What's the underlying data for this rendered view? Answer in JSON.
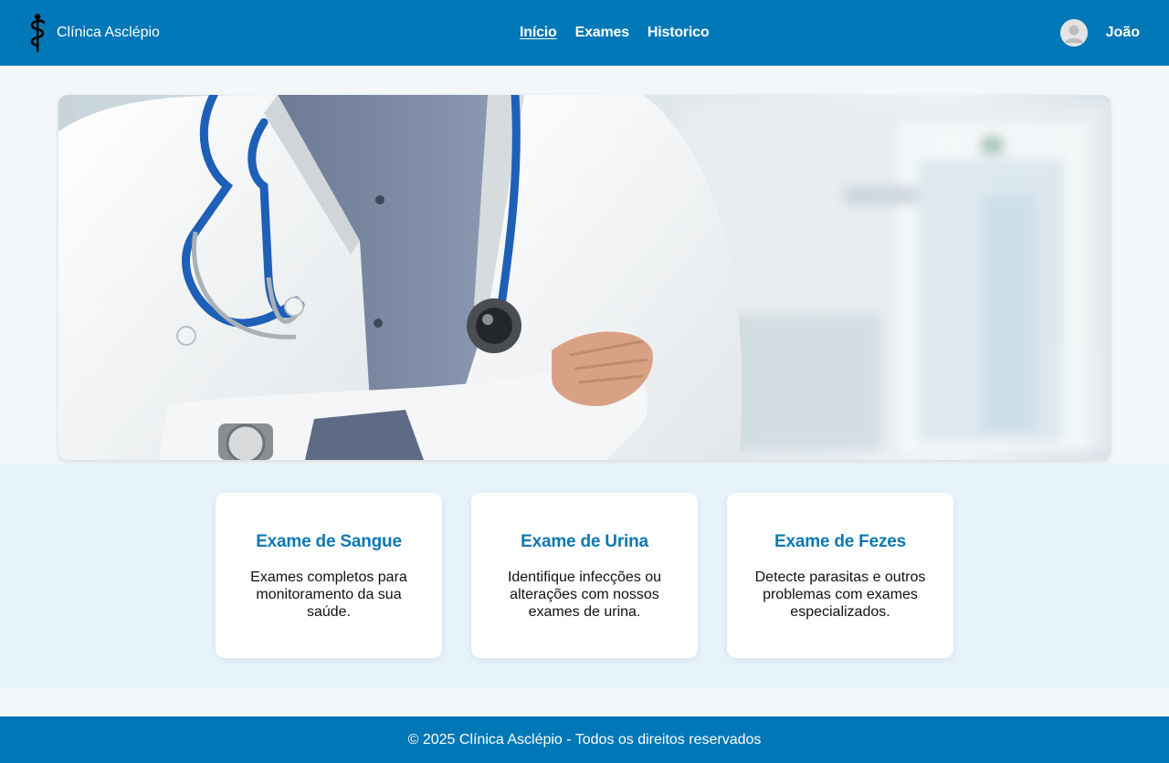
{
  "header": {
    "brand_name": "Clínica Asclépio",
    "logo_icon": "rod-of-asclepius-icon",
    "nav": [
      {
        "label": "Início",
        "active": true
      },
      {
        "label": "Exames",
        "active": false
      },
      {
        "label": "Historico",
        "active": false
      }
    ],
    "user": {
      "name": "João",
      "avatar_icon": "user-avatar-icon"
    }
  },
  "hero": {
    "image": "doctor-with-stethoscope-photo"
  },
  "services": [
    {
      "title": "Exame de Sangue",
      "description": "Exames completos para monitoramento da sua saúde."
    },
    {
      "title": "Exame de Urina",
      "description": "Identifique infecções ou alterações com nossos exames de urina."
    },
    {
      "title": "Exame de Fezes",
      "description": "Detecte parasitas e outros problemas com exames especializados."
    }
  ],
  "footer": {
    "text": "© 2025 Clínica Asclépio - Todos os direitos reservados"
  },
  "colors": {
    "primary": "#0077b6",
    "accent_text": "#0b78b3",
    "page_bg": "#f3f7fa",
    "services_bg": "#e6f3fb"
  }
}
